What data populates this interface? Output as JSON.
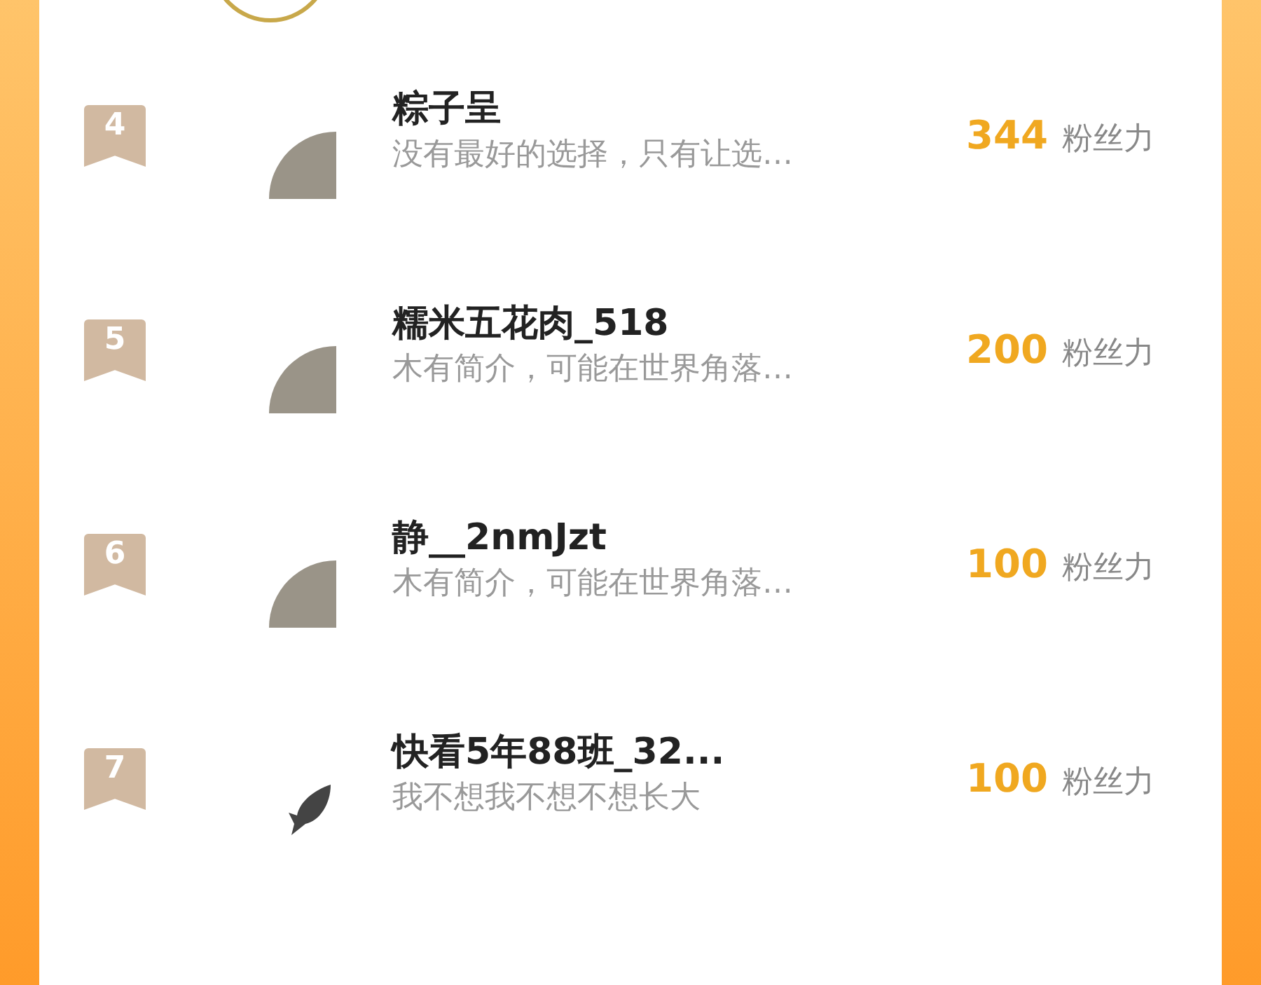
{
  "rows": [
    {
      "rank": "4",
      "name": "粽子呈",
      "bio": "没有最好的选择，只有让选…",
      "score": "344",
      "unit": "粉丝力",
      "avatar": {
        "kind": "photo"
      }
    },
    {
      "rank": "5",
      "name": "糯米五花肉_518",
      "bio": "木有简介，可能在世界角落…",
      "score": "200",
      "unit": "粉丝力",
      "avatar": {
        "kind": "photo"
      }
    },
    {
      "rank": "6",
      "name": "静__2nmJzt",
      "bio": "木有简介，可能在世界角落…",
      "score": "100",
      "unit": "粉丝力",
      "avatar": {
        "kind": "photo"
      }
    },
    {
      "rank": "7",
      "name": "快看5年88班_32...",
      "bio": "我不想我不想不想长大",
      "score": "100",
      "unit": "粉丝力",
      "avatar": {
        "kind": "fish"
      }
    }
  ]
}
